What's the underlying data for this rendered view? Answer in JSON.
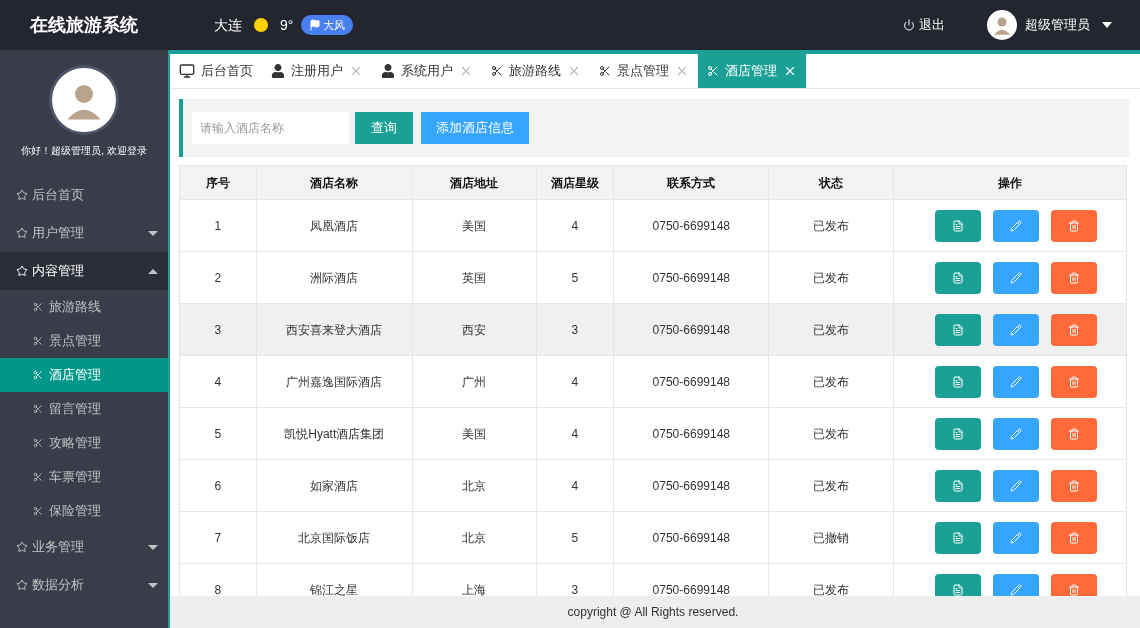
{
  "header": {
    "title": "在线旅游系统",
    "weather": {
      "city": "大连",
      "temp": "9°",
      "tag": "大风"
    },
    "logout": "退出",
    "user": "超级管理员"
  },
  "sidebar": {
    "greeting": "你好！超级管理员, 欢迎登录",
    "menu": [
      {
        "label": "后台首页",
        "kind": "link"
      },
      {
        "label": "用户管理",
        "kind": "group",
        "expanded": false
      },
      {
        "label": "内容管理",
        "kind": "group",
        "expanded": true,
        "children": [
          {
            "label": "旅游路线",
            "selected": false
          },
          {
            "label": "景点管理",
            "selected": false
          },
          {
            "label": "酒店管理",
            "selected": true
          },
          {
            "label": "留言管理",
            "selected": false
          },
          {
            "label": "攻略管理",
            "selected": false
          },
          {
            "label": "车票管理",
            "selected": false
          },
          {
            "label": "保险管理",
            "selected": false
          }
        ]
      },
      {
        "label": "业务管理",
        "kind": "group",
        "expanded": false
      },
      {
        "label": "数据分析",
        "kind": "group",
        "expanded": false
      }
    ]
  },
  "tabs": [
    {
      "label": "后台首页",
      "kind": "home",
      "closable": false,
      "selected": false
    },
    {
      "label": "注册用户",
      "kind": "account",
      "closable": true,
      "selected": false
    },
    {
      "label": "系统用户",
      "kind": "account",
      "closable": true,
      "selected": false
    },
    {
      "label": "旅游路线",
      "kind": "module",
      "closable": true,
      "selected": false
    },
    {
      "label": "景点管理",
      "kind": "module",
      "closable": true,
      "selected": false
    },
    {
      "label": "酒店管理",
      "kind": "module",
      "closable": true,
      "selected": true
    }
  ],
  "search": {
    "placeholder": "请输入酒店名称",
    "query_button": "查询",
    "add_button": "添加酒店信息"
  },
  "table": {
    "columns": [
      "序号",
      "酒店名称",
      "酒店地址",
      "酒店星级",
      "联系方式",
      "状态",
      "操作"
    ],
    "rows": [
      {
        "cells": [
          "1",
          "凤凰酒店",
          "美国",
          "4",
          "0750-6699148",
          "已发布"
        ],
        "hovered": false
      },
      {
        "cells": [
          "2",
          "洲际酒店",
          "英国",
          "5",
          "0750-6699148",
          "已发布"
        ],
        "hovered": false
      },
      {
        "cells": [
          "3",
          "西安喜来登大酒店",
          "西安",
          "3",
          "0750-6699148",
          "已发布"
        ],
        "hovered": true
      },
      {
        "cells": [
          "4",
          "广州嘉逸国际酒店",
          "广州",
          "4",
          "0750-6699148",
          "已发布"
        ],
        "hovered": false
      },
      {
        "cells": [
          "5",
          "凯悦Hyatt酒店集团",
          "美国",
          "4",
          "0750-6699148",
          "已发布"
        ],
        "hovered": false
      },
      {
        "cells": [
          "6",
          "如家酒店",
          "北京",
          "4",
          "0750-6699148",
          "已发布"
        ],
        "hovered": false
      },
      {
        "cells": [
          "7",
          "北京国际饭店",
          "北京",
          "5",
          "0750-6699148",
          "已撤销"
        ],
        "hovered": false
      },
      {
        "cells": [
          "8",
          "锦江之星",
          "上海",
          "3",
          "0750-6699148",
          "已发布"
        ],
        "hovered": false
      }
    ]
  },
  "footer": "copyright @ All Rights reserved."
}
